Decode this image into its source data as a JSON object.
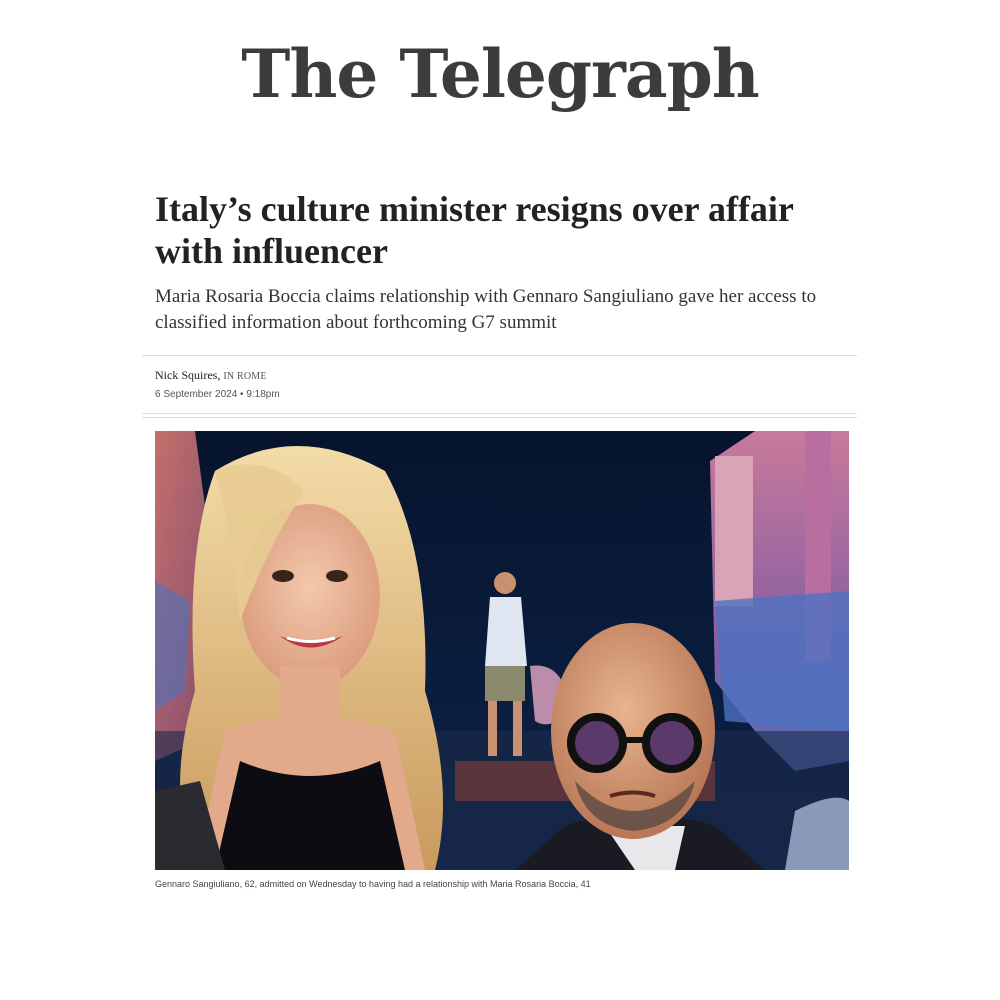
{
  "masthead": {
    "title": "The Telegraph"
  },
  "article": {
    "headline": "Italy’s culture minister resigns over affair with influencer",
    "standfirst": "Maria Rosaria Boccia claims relationship with Gennaro Sangiuliano gave her access to classified information about forthcoming G7 summit",
    "author": "Nick Squires,",
    "location": "IN ROME",
    "date": "6 September 2024 • 9:18pm",
    "image_caption": "Gennaro Sangiuliano, 62, admitted on Wednesday to having had a relationship with Maria Rosaria Boccia, 41"
  }
}
